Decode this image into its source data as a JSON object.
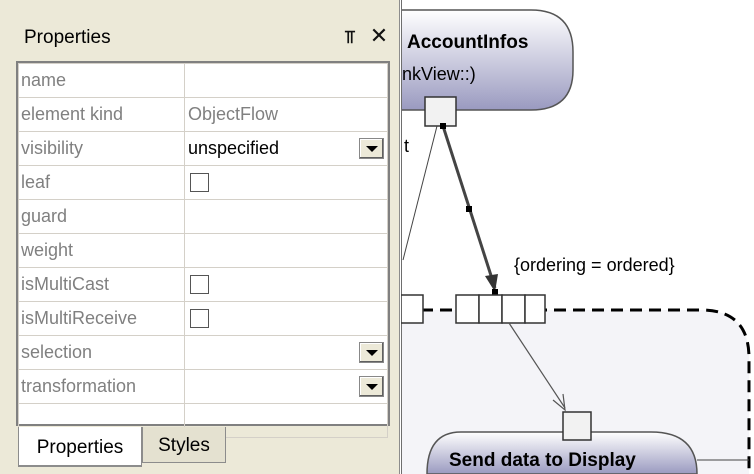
{
  "panel": {
    "title": "Properties",
    "pin_icon": "pin-icon",
    "close_icon": "close-icon",
    "rows": [
      {
        "name": "name",
        "value": "",
        "kind": "text"
      },
      {
        "name": "element kind",
        "value": "ObjectFlow",
        "kind": "readonly"
      },
      {
        "name": "visibility",
        "value": "unspecified",
        "kind": "select"
      },
      {
        "name": "leaf",
        "value": "",
        "kind": "checkbox",
        "checked": false
      },
      {
        "name": "guard",
        "value": "",
        "kind": "text"
      },
      {
        "name": "weight",
        "value": "",
        "kind": "text"
      },
      {
        "name": "isMultiCast",
        "value": "",
        "kind": "checkbox",
        "checked": false
      },
      {
        "name": "isMultiReceive",
        "value": "",
        "kind": "checkbox",
        "checked": false
      },
      {
        "name": "selection",
        "value": "",
        "kind": "select"
      },
      {
        "name": "transformation",
        "value": "",
        "kind": "select"
      }
    ],
    "tabs": [
      {
        "label": "Properties",
        "active": true
      },
      {
        "label": "Styles",
        "active": false
      }
    ]
  },
  "diagram": {
    "account_node_title": "AccountInfos",
    "account_node_subtitle": "nkView::)",
    "edge_label_fragment": "t",
    "ordering_label": "{ordering = ordered}",
    "send_node_title": "Send data to Display"
  },
  "colors": {
    "panel_bg": "#ece9d8",
    "grid_border": "#d4d0c8",
    "node_fill_top": "#ffffff",
    "node_fill_bottom": "#9a9ac0",
    "region_fill": "#f4f4f8"
  }
}
